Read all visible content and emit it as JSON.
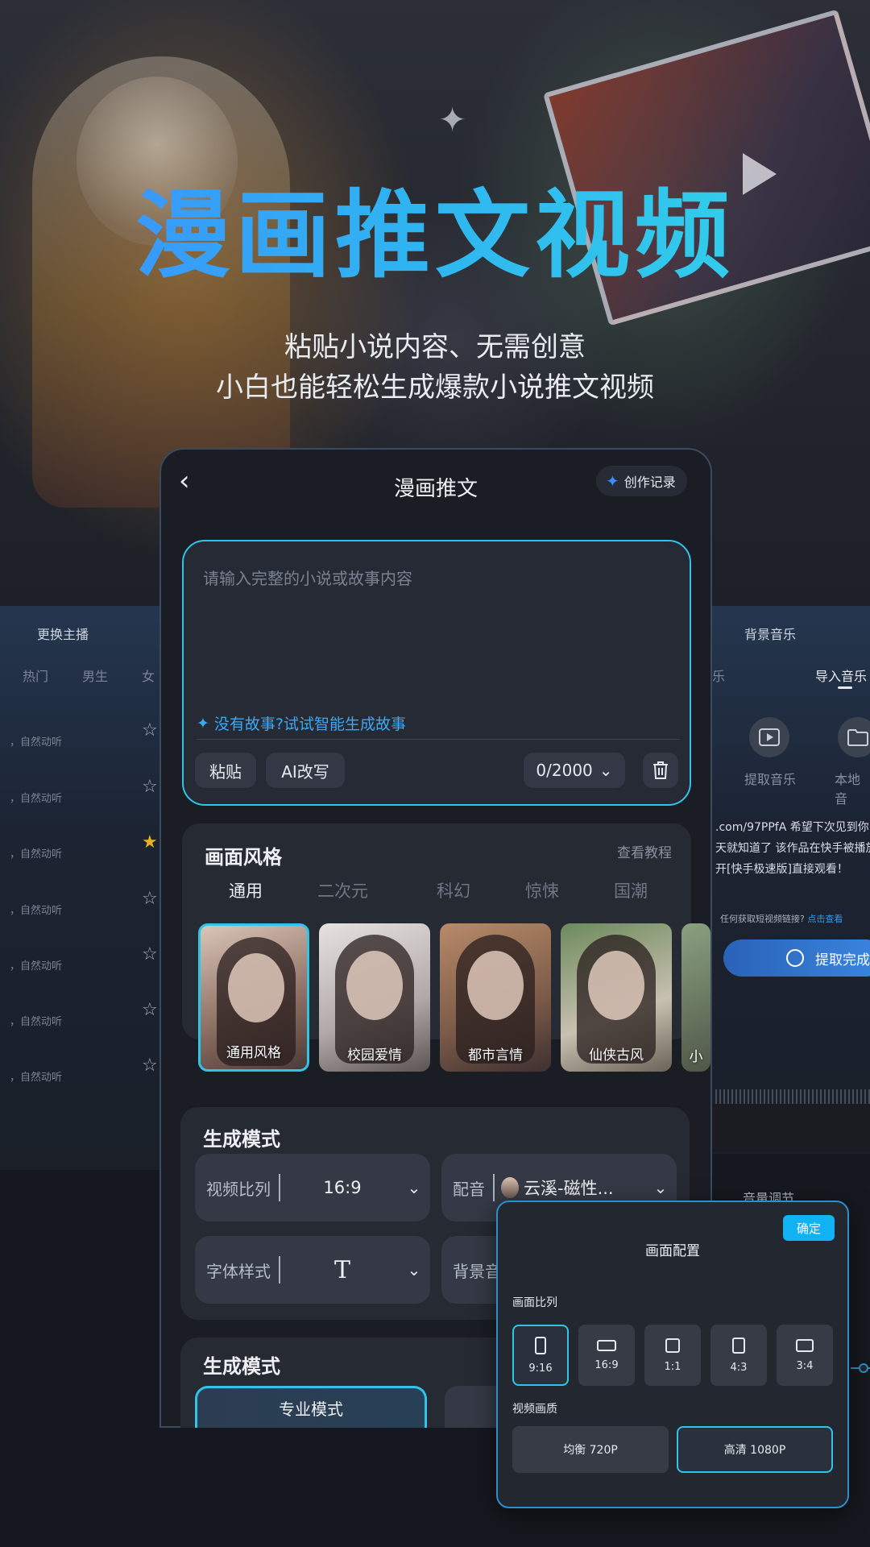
{
  "hero": {
    "title": "漫画推文视频",
    "subtitle_line1": "粘贴小说内容、无需创意",
    "subtitle_line2": "小白也能轻松生成爆款小说推文视频"
  },
  "left_panel": {
    "title": "更换主播",
    "tabs": [
      "热门",
      "男生",
      "女"
    ],
    "rows": [
      "，自然动听",
      "，自然动听",
      "，自然动听",
      "，自然动听",
      "，自然动听",
      "，自然动听",
      "，自然动听"
    ],
    "favorite_index": 2
  },
  "right_panel": {
    "title": "背景音乐",
    "tabs": [
      "乐",
      "导入音乐"
    ],
    "icons": [
      {
        "label": "提取音乐",
        "icon": "video-play-icon"
      },
      {
        "label": "本地音",
        "icon": "folder-icon"
      }
    ],
    "link_text": [
      ".com/97PPfA 希望下次见到你",
      "天就知道了 该作品在快手被播放",
      "开[快手极速版]直接观看！"
    ],
    "hint": "任何获取短视频链接?",
    "hint_link": "点击查看",
    "extract_button": "提取完成",
    "volume_label": "音量调节"
  },
  "phone": {
    "title": "漫画推文",
    "record_button": "创作记录",
    "story": {
      "placeholder": "请输入完整的小说或故事内容",
      "ai_hint": "没有故事?试试智能生成故事",
      "paste": "粘贴",
      "ai_rewrite": "AI改写",
      "count": "0/2000"
    },
    "style": {
      "title": "画面风格",
      "tutorial": "查看教程",
      "tabs": [
        "通用",
        "二次元",
        "科幻",
        "惊悚",
        "国潮"
      ],
      "thumbs": [
        "通用风格",
        "校园爱情",
        "都市言情",
        "仙侠古风",
        "小"
      ]
    },
    "gen1": {
      "title": "生成模式",
      "ratio_label": "视频比列",
      "ratio_value": "16:9",
      "voice_label": "配音",
      "voice_value": "云溪-磁性...",
      "font_label": "字体样式",
      "font_value": "T",
      "bg_label": "背景音"
    },
    "gen2": {
      "title": "生成模式",
      "pro_mode": "专业模式"
    }
  },
  "popover": {
    "confirm": "确定",
    "title": "画面配置",
    "ratio_label": "画面比列",
    "ratios": [
      "9:16",
      "16:9",
      "1:1",
      "4:3",
      "3:4"
    ],
    "quality_label": "视频画质",
    "qualities": [
      "均衡 720P",
      "高清 1080P"
    ]
  },
  "colors": {
    "accent": "#2fc4e8",
    "title_gradient_start": "#3d8cff",
    "title_gradient_end": "#33d6e8",
    "confirm": "#10b2f2",
    "star_filled": "#e8b21e"
  }
}
